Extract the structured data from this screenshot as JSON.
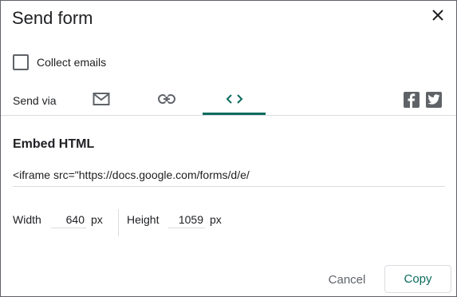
{
  "dialog": {
    "title": "Send form",
    "close_icon": "close-icon"
  },
  "collect_emails": {
    "label": "Collect emails",
    "checked": false
  },
  "send_via": {
    "label": "Send via",
    "tabs": [
      {
        "icon": "email-icon",
        "selected": false
      },
      {
        "icon": "link-icon",
        "selected": false
      },
      {
        "icon": "embed-code-icon",
        "selected": true
      }
    ],
    "social": [
      {
        "icon": "facebook-icon"
      },
      {
        "icon": "twitter-icon"
      }
    ]
  },
  "embed": {
    "title": "Embed HTML",
    "code": "<iframe src=\"https://docs.google.com/forms/d/e/",
    "width_label": "Width",
    "width_value": "640",
    "width_unit": "px",
    "height_label": "Height",
    "height_value": "1059",
    "height_unit": "px"
  },
  "actions": {
    "cancel_label": "Cancel",
    "copy_label": "Copy"
  },
  "colors": {
    "accent": "#0b6b5d",
    "text": "#202124",
    "secondary_text": "#5f6368",
    "divider": "#dadce0"
  }
}
